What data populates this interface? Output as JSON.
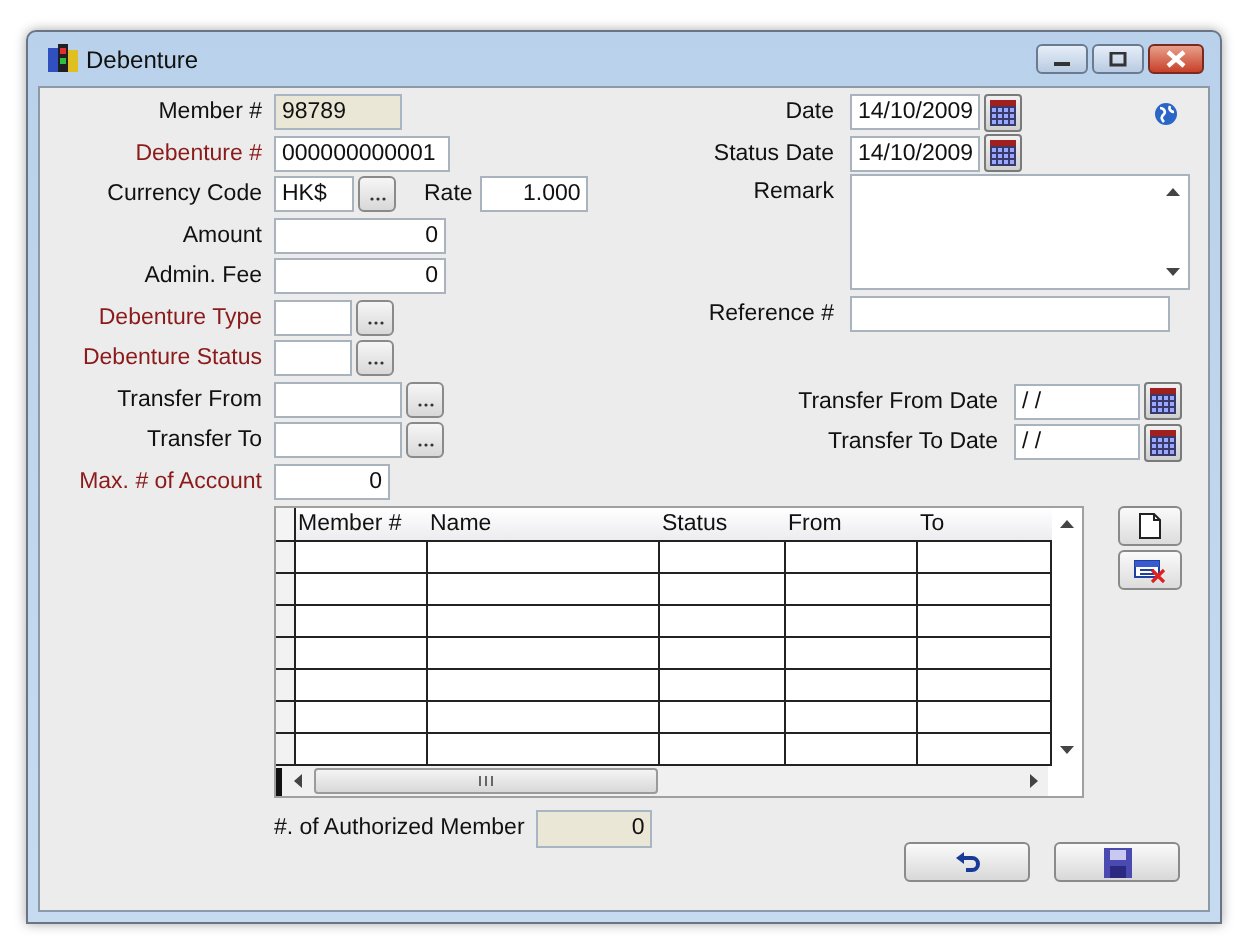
{
  "window": {
    "title": "Debenture"
  },
  "left_fields": [
    {
      "label": "Member #",
      "value": "98789",
      "kind": "short",
      "required": false,
      "readonly": true
    },
    {
      "label": "Debenture #",
      "value": "000000000001",
      "kind": "text",
      "required": true,
      "readonly": false
    },
    {
      "label": "Currency Code",
      "value": "HK$",
      "kind": "currency",
      "required": false,
      "readonly": false,
      "rate_label": "Rate",
      "rate_value": "1.000"
    },
    {
      "label": "Amount",
      "value": "0",
      "kind": "amount",
      "required": false,
      "readonly": false
    },
    {
      "label": "Admin. Fee",
      "value": "0",
      "kind": "amount",
      "required": false,
      "readonly": false
    },
    {
      "label": "Debenture Type",
      "kind": "code_lookup",
      "required": true,
      "readonly": false
    },
    {
      "label": "Debenture Status",
      "kind": "code_lookup",
      "required": true,
      "readonly": false
    },
    {
      "label": "Transfer From",
      "kind": "member_lookup",
      "required": false,
      "readonly": false
    },
    {
      "label": "Transfer To",
      "kind": "member_lookup",
      "required": false,
      "readonly": false
    },
    {
      "label": "Max. # of Account",
      "value": "0",
      "kind": "count",
      "required": true,
      "readonly": false
    }
  ],
  "right_fields": [
    {
      "label": "Date",
      "value": "14/10/2009",
      "kind": "date"
    },
    {
      "label": "Status Date",
      "value": "14/10/2009",
      "kind": "date"
    },
    {
      "label": "Remark",
      "kind": "memo"
    },
    {
      "label": "Reference #",
      "kind": "text"
    },
    {
      "label": "Transfer From Date",
      "value": " / /",
      "kind": "range_date"
    },
    {
      "label": "Transfer To Date",
      "value": " / /",
      "kind": "range_date"
    }
  ],
  "table": {
    "columns": [
      "Member #",
      "Name",
      "Status",
      "From",
      "To"
    ]
  },
  "authorized": {
    "label": "#. of Authorized Member",
    "value": "0"
  }
}
